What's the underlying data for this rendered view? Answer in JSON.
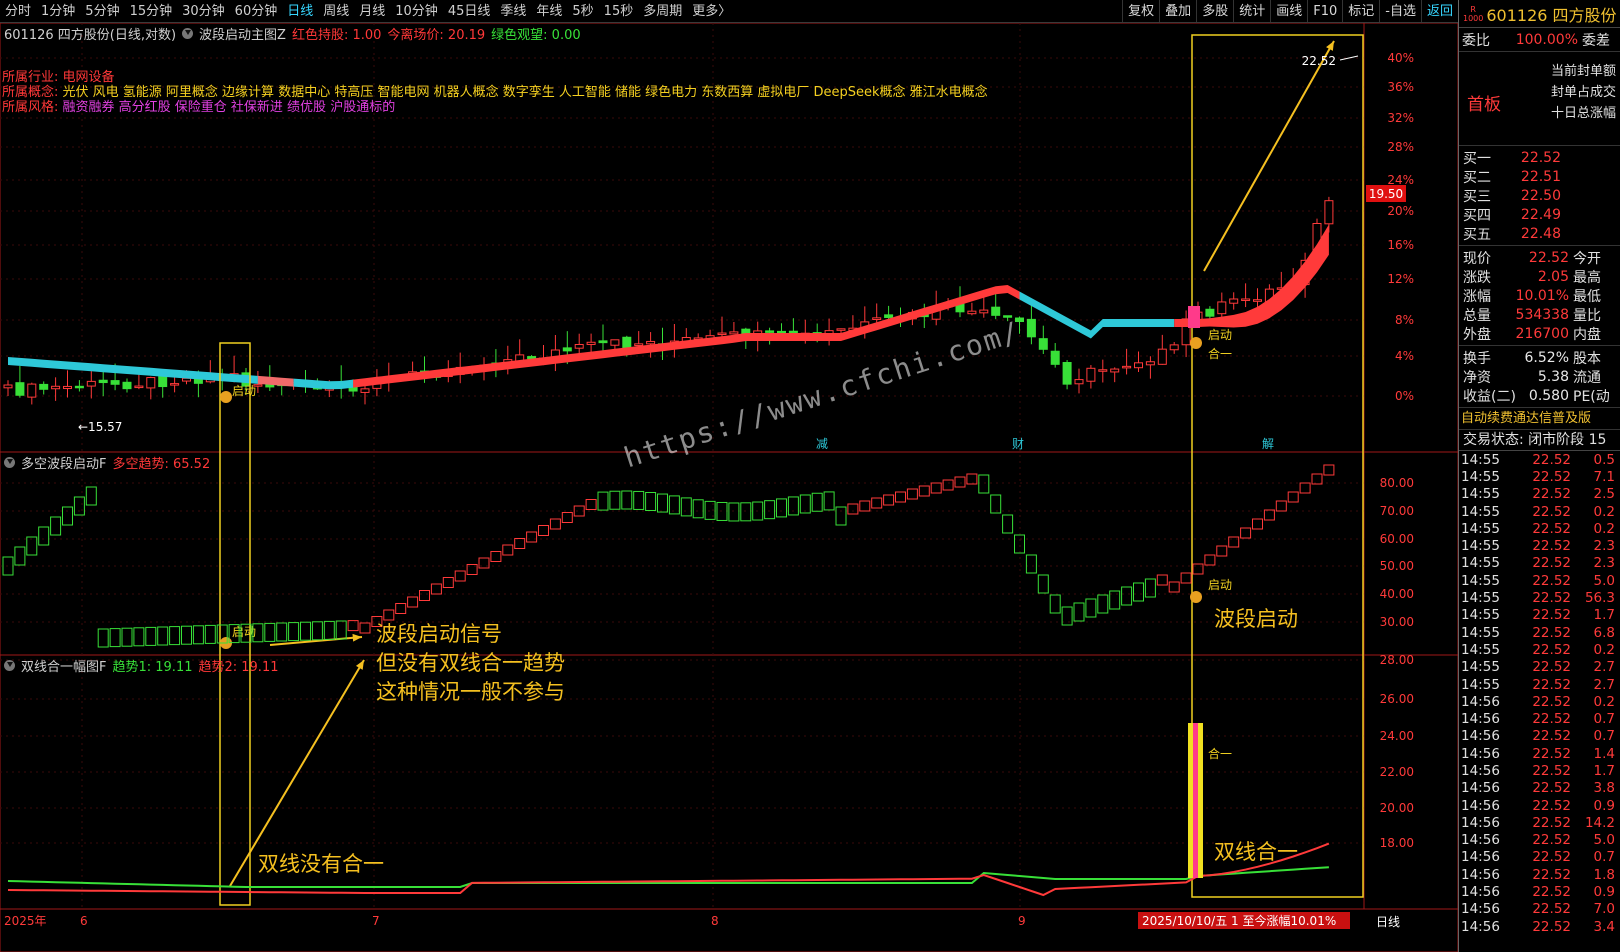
{
  "toolbar": {
    "periods": [
      "分时",
      "1分钟",
      "5分钟",
      "15分钟",
      "30分钟",
      "60分钟",
      "日线",
      "周线",
      "月线",
      "10分钟",
      "45日线",
      "季线",
      "年线",
      "5秒",
      "15秒",
      "多周期",
      "更多〉"
    ],
    "active": "日线",
    "right_tools": [
      "复权",
      "叠加",
      "多股",
      "统计",
      "画线",
      "F10",
      "标记",
      "-自选",
      "返回"
    ]
  },
  "main_pane": {
    "title": "601126 四方股份(日线,对数)",
    "indicator": "波段启动主图Z",
    "red_hold_label": "红色持股: 1.00",
    "exit_label": "今离场价: 20.19",
    "green_watch_label": "绿色观望: 0.00",
    "industry_key": "所属行业:",
    "industry": "电网设备",
    "concept_key": "所属概念:",
    "concepts": "光伏 风电 氢能源 阿里概念 边缘计算 数据中心 特高压 智能电网 机器人概念 数字孪生 人工智能 储能 绿色电力 东数西算 虚拟电厂 DeepSeek概念 雅江水电概念",
    "style_key": "所属风格:",
    "styles": "融资融券 高分红股 保险重仓 社保新进 绩优股 沪股通标的",
    "high_label": "22.52",
    "low_label": "←15.57",
    "current_price_tag": "19.50",
    "pct_axis": [
      "40%",
      "36%",
      "32%",
      "28%",
      "24%",
      "20%",
      "16%",
      "12%",
      "8%",
      "4%",
      "0%"
    ],
    "signal_start": "启动",
    "signal_merge": "合一",
    "markers": [
      "减",
      "财",
      "解"
    ]
  },
  "pane2": {
    "title": "多空波段启动F",
    "value_label": "多空趋势: 65.52",
    "axis": [
      "80.00",
      "70.00",
      "60.00",
      "50.00",
      "40.00",
      "30.00"
    ]
  },
  "pane3": {
    "title": "双线合一幅图F",
    "trend1_label": "趋势1: 19.11",
    "trend2_label": "趋势2: 19.11",
    "axis": [
      "28.00",
      "26.00",
      "24.00",
      "22.00",
      "20.00",
      "18.00"
    ]
  },
  "x_axis": {
    "labels": [
      "2025年",
      "6",
      "7",
      "8",
      "9"
    ],
    "date_bar": "2025/10/10/五 1 至今涨幅10.01%",
    "period": "日线"
  },
  "annotations": {
    "left_signal": [
      "波段启动信号",
      "但没有双线合一趋势",
      "这种情况一般不参与"
    ],
    "left_no_merge": "双线没有合一",
    "right_start": "波段启动",
    "right_merge": "双线合一",
    "watermark": "https://www.cfchi.com/"
  },
  "chart_data": {
    "type": "candlestick",
    "symbol": "601126",
    "high": 22.52,
    "low": 15.57,
    "last": 22.52,
    "exit_price": 20.19,
    "trend_value": 65.52,
    "trend1": 19.11,
    "trend2": 19.11,
    "x_months": [
      "6",
      "7",
      "8",
      "9",
      "10"
    ]
  },
  "side": {
    "logo_r": "R",
    "logo_n": "1000",
    "name": "601126 四方股份",
    "webi_label": "委比",
    "webi_value": "100.00%",
    "weicha_label": "委差",
    "first_board": "首板",
    "seal_lines": [
      "当前封单额",
      "封单占成交",
      "十日总涨幅"
    ],
    "book": [
      {
        "label": "买一",
        "price": "22.52"
      },
      {
        "label": "买二",
        "price": "22.51"
      },
      {
        "label": "买三",
        "price": "22.50"
      },
      {
        "label": "买四",
        "price": "22.49"
      },
      {
        "label": "买五",
        "price": "22.48"
      }
    ],
    "quote": [
      {
        "label": "现价",
        "value": "22.52",
        "red": true,
        "label2": "今开"
      },
      {
        "label": "涨跌",
        "value": "2.05",
        "red": true,
        "label2": "最高"
      },
      {
        "label": "涨幅",
        "value": "10.01%",
        "red": true,
        "label2": "最低"
      },
      {
        "label": "总量",
        "value": "534338",
        "red": true,
        "label2": "量比"
      },
      {
        "label": "外盘",
        "value": "216700",
        "red": true,
        "label2": "内盘"
      }
    ],
    "quote2": [
      {
        "label": "换手",
        "value": "6.52%",
        "label2": "股本"
      },
      {
        "label": "净资",
        "value": "5.38",
        "label2": "流通"
      },
      {
        "label": "收益(二)",
        "value": "0.580",
        "label2": "PE(动"
      }
    ],
    "promo": "自动续费通达信普及版",
    "status": "交易状态: 闭市阶段 15",
    "ticks": [
      {
        "t": "14:55",
        "p": "22.52",
        "v": "0.5"
      },
      {
        "t": "14:55",
        "p": "22.52",
        "v": "7.1"
      },
      {
        "t": "14:55",
        "p": "22.52",
        "v": "2.5"
      },
      {
        "t": "14:55",
        "p": "22.52",
        "v": "0.2"
      },
      {
        "t": "14:55",
        "p": "22.52",
        "v": "0.2"
      },
      {
        "t": "14:55",
        "p": "22.52",
        "v": "2.3"
      },
      {
        "t": "14:55",
        "p": "22.52",
        "v": "2.3"
      },
      {
        "t": "14:55",
        "p": "22.52",
        "v": "5.0"
      },
      {
        "t": "14:55",
        "p": "22.52",
        "v": "56.3"
      },
      {
        "t": "14:55",
        "p": "22.52",
        "v": "1.7"
      },
      {
        "t": "14:55",
        "p": "22.52",
        "v": "6.8"
      },
      {
        "t": "14:55",
        "p": "22.52",
        "v": "0.2"
      },
      {
        "t": "14:55",
        "p": "22.52",
        "v": "2.7"
      },
      {
        "t": "14:55",
        "p": "22.52",
        "v": "2.7"
      },
      {
        "t": "14:56",
        "p": "22.52",
        "v": "0.2"
      },
      {
        "t": "14:56",
        "p": "22.52",
        "v": "0.7"
      },
      {
        "t": "14:56",
        "p": "22.52",
        "v": "0.7"
      },
      {
        "t": "14:56",
        "p": "22.52",
        "v": "1.4"
      },
      {
        "t": "14:56",
        "p": "22.52",
        "v": "1.7"
      },
      {
        "t": "14:56",
        "p": "22.52",
        "v": "3.8"
      },
      {
        "t": "14:56",
        "p": "22.52",
        "v": "0.9"
      },
      {
        "t": "14:56",
        "p": "22.52",
        "v": "14.2"
      },
      {
        "t": "14:56",
        "p": "22.52",
        "v": "5.0"
      },
      {
        "t": "14:56",
        "p": "22.52",
        "v": "0.7"
      },
      {
        "t": "14:56",
        "p": "22.52",
        "v": "1.8"
      },
      {
        "t": "14:56",
        "p": "22.52",
        "v": "0.9"
      },
      {
        "t": "14:56",
        "p": "22.52",
        "v": "7.0"
      },
      {
        "t": "14:56",
        "p": "22.52",
        "v": "3.4"
      }
    ]
  }
}
